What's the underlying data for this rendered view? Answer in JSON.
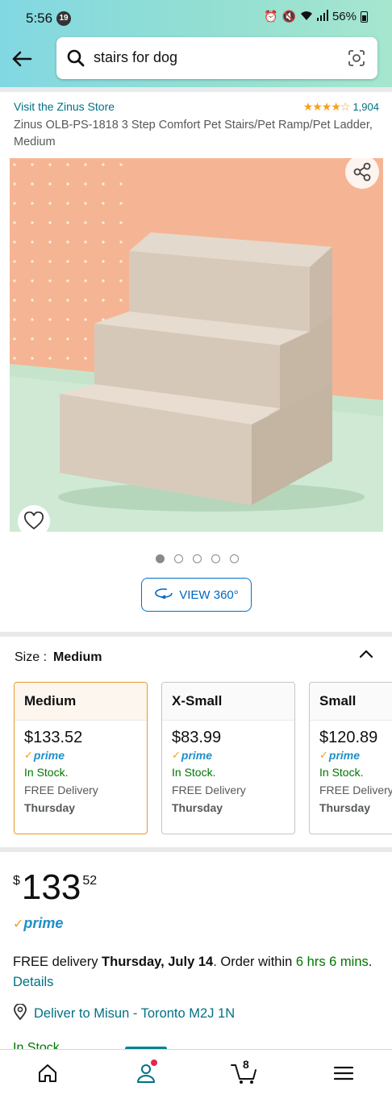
{
  "status_bar": {
    "time": "5:56",
    "notification_count": "19",
    "battery": "56%"
  },
  "search": {
    "query": "stairs for dog"
  },
  "product": {
    "store_link": "Visit the Zinus Store",
    "rating_stars": 4.5,
    "rating_count": "1,904",
    "title": "Zinus OLB-PS-1818 3 Step Comfort Pet Stairs/Pet Ramp/Pet Ladder, Medium",
    "image_count": 5,
    "active_image_index": 0,
    "view360_label": "VIEW 360°"
  },
  "size": {
    "label": "Size :",
    "selected": "Medium",
    "options": [
      {
        "name": "Medium",
        "price": "$133.52",
        "prime": "prime",
        "stock": "In Stock.",
        "delivery": "FREE Delivery",
        "day": "Thursday",
        "selected": true
      },
      {
        "name": "X-Small",
        "price": "$83.99",
        "prime": "prime",
        "stock": "In Stock.",
        "delivery": "FREE Delivery",
        "day": "Thursday",
        "selected": false
      },
      {
        "name": "Small",
        "price": "$120.89",
        "prime": "prime",
        "stock": "In Stock.",
        "delivery": "FREE Delivery",
        "day": "Thursday",
        "selected": false
      }
    ]
  },
  "buy_box": {
    "price_symbol": "$",
    "price_whole": "133",
    "price_fraction": "52",
    "prime": "prime",
    "delivery_prefix": "FREE delivery ",
    "delivery_date": "Thursday, July 14",
    "delivery_mid": ". Order within ",
    "order_within": "6 hrs 6 mins",
    "delivery_end": ". ",
    "details_link": "Details",
    "deliver_to": "Deliver to Misun - Toronto M2J 1N",
    "stock_partial": "In Stock."
  },
  "bottom_nav": {
    "items": [
      "home",
      "you",
      "cart",
      "menu"
    ],
    "active": "you",
    "cart_count": "8"
  },
  "colors": {
    "link": "#007185",
    "in_stock": "#007600",
    "prime_blue": "#1e8fc9",
    "selected_border": "#e39a2b",
    "header_gradient_start": "#82d8e2",
    "header_gradient_end": "#a6e6cf"
  }
}
